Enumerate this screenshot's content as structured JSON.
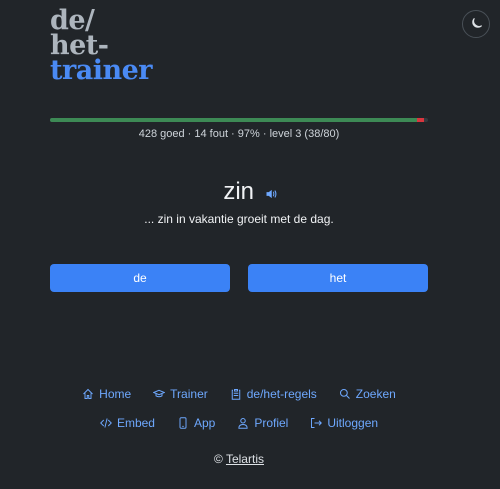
{
  "logo": {
    "line1": "de/",
    "line2": "het-",
    "line3": "trainer"
  },
  "progress": {
    "good_fraction": 0.97,
    "text": "428 goed · 14 fout · 97% · level 3 (38/80)"
  },
  "word": "zin",
  "sentence": "... zin in vakantie groeit met de dag.",
  "buttons": {
    "de": "de",
    "het": "het"
  },
  "nav": {
    "home": "Home",
    "trainer": "Trainer",
    "rules": "de/het-regels",
    "search": "Zoeken",
    "embed": "Embed",
    "app": "App",
    "profile": "Profiel",
    "logout": "Uitloggen"
  },
  "footer": {
    "copyright": "©",
    "name": "Telartis"
  },
  "colors": {
    "background": "#212529",
    "accent": "#3b82f6",
    "link": "#6ea8fe",
    "good": "#3d8a55",
    "bad": "#d9363e"
  }
}
